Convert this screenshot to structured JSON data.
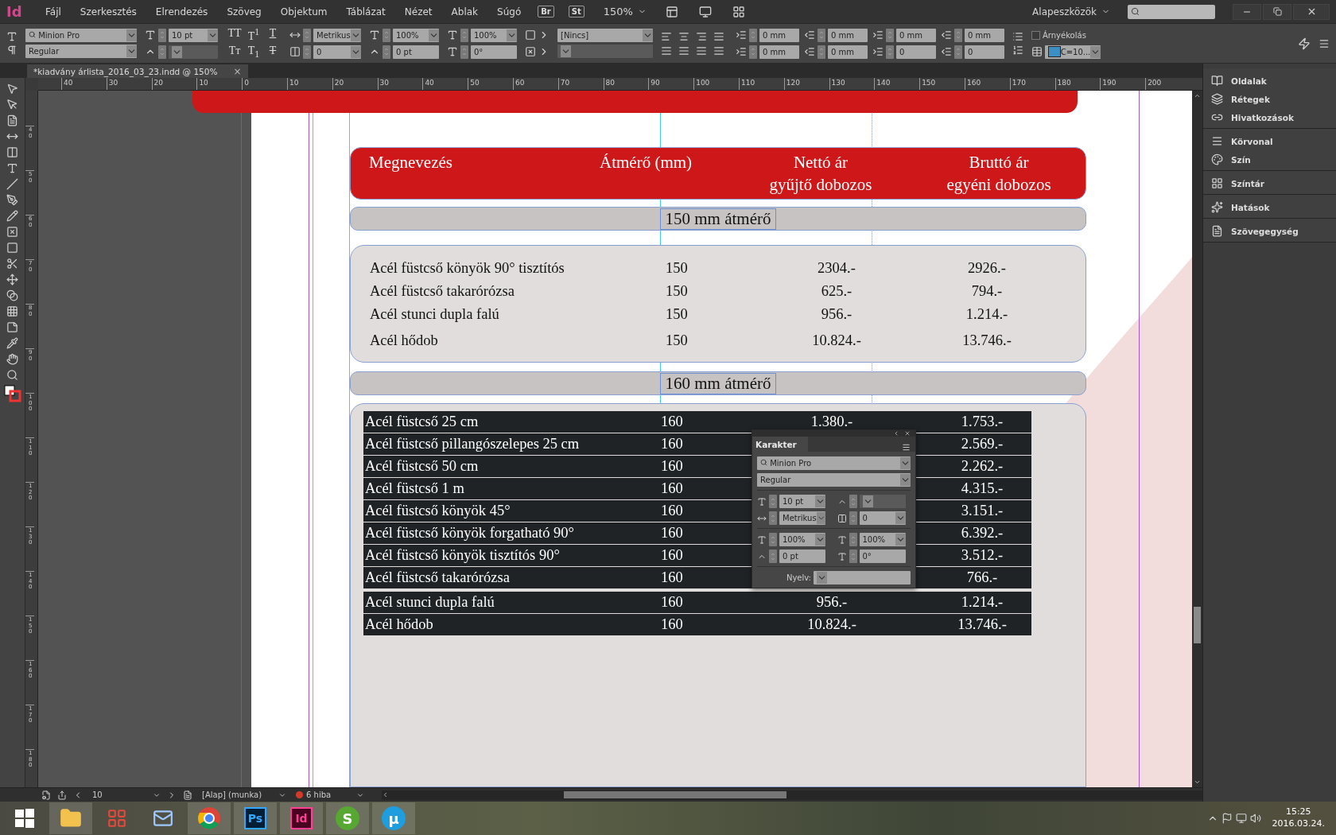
{
  "app": {
    "logo": "Id",
    "menu": [
      "Fájl",
      "Szerkesztés",
      "Elrendezés",
      "Szöveg",
      "Objektum",
      "Táblázat",
      "Nézet",
      "Ablak",
      "Súgó"
    ],
    "bridge": "Br",
    "stock": "St",
    "zoom": "150%",
    "workspace": "Alapeszközök"
  },
  "control_bar": {
    "font": "Minion Pro",
    "style": "Regular",
    "size": "10 pt",
    "tracking": "Metrikus",
    "kerning": "0",
    "vertical_scale": "100%",
    "baseline_shift": "0 pt",
    "horizontal_scale": "100%",
    "skew": "0°",
    "case_buttons": [
      {
        "label": "TT",
        "kind": "plain"
      },
      {
        "label": "T$^{1}$",
        "kind": "plain"
      },
      {
        "label": "T",
        "kind": "underline"
      },
      {
        "label": "Tт",
        "kind": "plain"
      },
      {
        "label": "T$_{1}$",
        "kind": "plain"
      },
      {
        "label": "T",
        "kind": "strike"
      }
    ],
    "char_style": "[Nincs]",
    "indents": [
      "0 mm",
      "0 mm",
      "0 mm",
      "0 mm",
      "0 mm",
      "0 mm",
      "0",
      "0"
    ],
    "shading": {
      "label": "Árnyékolás",
      "checked": false
    },
    "swatch": "C=10..."
  },
  "document_tab": {
    "title": "*kiadvány árlista_2016_03_23.indd @ 150%",
    "close": "×"
  },
  "rulers": {
    "horizontal": [
      "40",
      "30",
      "20",
      "10",
      "0",
      "10",
      "20",
      "30",
      "40",
      "50",
      "60",
      "70",
      "80",
      "90",
      "100",
      "110",
      "120",
      "130",
      "140",
      "150",
      "160",
      "170",
      "180",
      "190",
      "200"
    ],
    "vertical": [
      "40",
      "50",
      "60",
      "70",
      "80",
      "90",
      "100",
      "110",
      "120",
      "130",
      "140",
      "150",
      "160",
      "170",
      "180"
    ]
  },
  "table": {
    "header": [
      "Megnevezés",
      "Átmérő (mm)",
      "Nettó ár\ngyűjtő dobozos",
      "Bruttó ár\negyéni dobozos"
    ],
    "sections": [
      {
        "title": "150 mm átmérő",
        "rows": [
          {
            "name": "Acél füstcső könyök 90° tisztítós",
            "diameter": "150",
            "net": "2304.-",
            "gross": "2926.-"
          },
          {
            "name": "Acél füstcső takarórózsa",
            "diameter": "150",
            "net": "625.-",
            "gross": "794.-"
          },
          {
            "name": "Acél stunci dupla falú",
            "diameter": "150",
            "net": "956.-",
            "gross": "1.214.-"
          },
          {
            "name": "Acél hődob",
            "diameter": "150",
            "net": "10.824.-",
            "gross": "13.746.-"
          }
        ]
      },
      {
        "title": "160 mm átmérő",
        "rows": [
          {
            "name": "Acél füstcső 25 cm",
            "diameter": "160",
            "net": "1.380.-",
            "gross": "1.753.-"
          },
          {
            "name": "Acél füstcső pillangószelepes 25 cm",
            "diameter": "160",
            "gross": "2.569.-"
          },
          {
            "name": "Acél füstcső 50 cm",
            "diameter": "160",
            "gross": "2.262.-"
          },
          {
            "name": "Acél füstcső 1 m",
            "diameter": "160",
            "gross": "4.315.-"
          },
          {
            "name": "Acél füstcső könyök 45°",
            "diameter": "160",
            "gross": "3.151.-"
          },
          {
            "name": "Acél füstcső könyök forgatható 90°",
            "diameter": "160",
            "gross": "6.392.-"
          },
          {
            "name": "Acél füstcső könyök tisztítós 90°",
            "diameter": "160",
            "gross": "3.512.-"
          },
          {
            "name": "Acél füstcső takarórózsa",
            "diameter": "160",
            "gross": "766.-"
          },
          {
            "name": "Acél stunci dupla falú",
            "diameter": "160",
            "net": "956.-",
            "gross": "1.214.-"
          },
          {
            "name": "Acél hődob",
            "diameter": "160",
            "net": "10.824.-",
            "gross": "13.746.-"
          }
        ]
      }
    ]
  },
  "character_panel": {
    "title": "Karakter",
    "font": "Minion Pro",
    "style": "Regular",
    "size": "10 pt",
    "tracking": "Metrikus",
    "kerning": "0",
    "vertical_scale": "100%",
    "horizontal_scale": "100%",
    "baseline_shift": "0 pt",
    "skew": "0°",
    "language_label": "Nyelv:"
  },
  "panels": [
    {
      "items": [
        "Oldalak",
        "Rétegek",
        "Hivatkozások"
      ]
    },
    {
      "items": [
        "Körvonal",
        "Szín"
      ]
    },
    {
      "items": [
        "Színtár"
      ]
    },
    {
      "items": [
        "Hatások"
      ]
    },
    {
      "items": [
        "Szövegegység"
      ]
    }
  ],
  "status_bar": {
    "page": "10",
    "master": "[Alap] (munka)",
    "errors": "6 hiba"
  },
  "taskbar": {
    "apps": [
      {
        "kind": "windows"
      },
      {
        "kind": "folder"
      },
      {
        "kind": "apps"
      },
      {
        "kind": "mail"
      },
      {
        "kind": "browser"
      },
      {
        "kind": "badge",
        "label": "Ps"
      },
      {
        "kind": "badge",
        "label": "Id"
      },
      {
        "kind": "round",
        "label": "S"
      },
      {
        "kind": "round",
        "label": "µ"
      }
    ],
    "time": "15:25",
    "date": "2016.03.24."
  }
}
